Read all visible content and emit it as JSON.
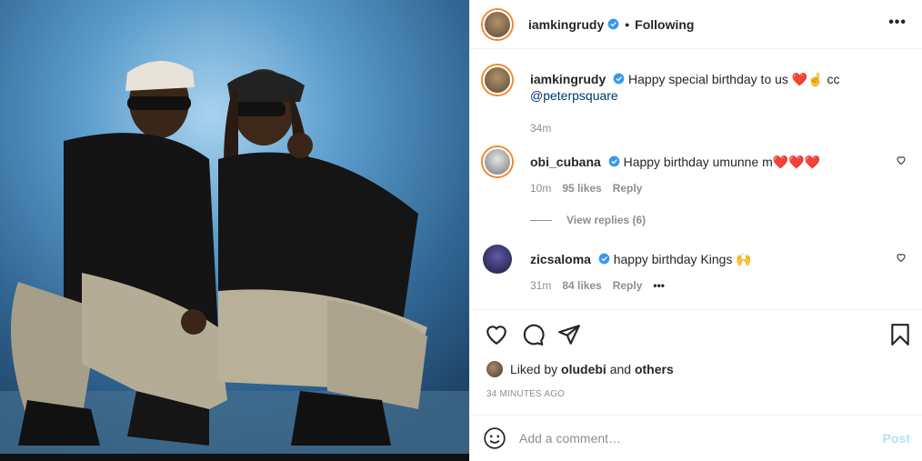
{
  "post": {
    "username": "iamkingrudy",
    "follow_status": "Following",
    "more_label": "•••"
  },
  "caption": {
    "username": "iamkingrudy",
    "text": "Happy special birthday to us ❤️☝️ cc",
    "mention": "@peterpsquare",
    "time": "34m"
  },
  "comments": [
    {
      "username": "obi_cubana",
      "text": "Happy birthday umunne m❤️❤️❤️",
      "time": "10m",
      "likes": "95 likes",
      "reply": "Reply"
    },
    {
      "username": "zicsaloma",
      "text": "happy birthday Kings 🙌",
      "time": "31m",
      "likes": "84 likes",
      "reply": "Reply",
      "more": "•••"
    }
  ],
  "view_replies": "View replies (6)",
  "likes": {
    "prefix": "Liked by",
    "user": "oludebi",
    "and": "and",
    "others": "others"
  },
  "timeago": "34 MINUTES AGO",
  "add_comment": {
    "placeholder": "Add a comment…",
    "post_label": "Post"
  },
  "colors": {
    "verified": "#3897f0",
    "link": "#00376b",
    "muted": "#8e8e8e",
    "post_disabled": "#b2dffc"
  }
}
